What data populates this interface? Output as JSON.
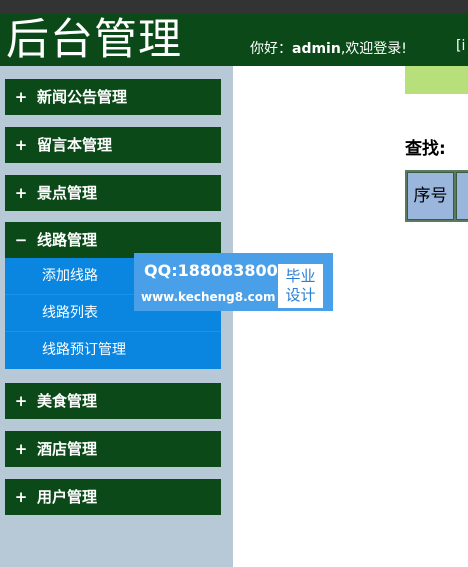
{
  "header": {
    "site_title": "后台管理",
    "welcome_prefix": "你好：",
    "username": "admin",
    "welcome_suffix": ",欢迎登录!",
    "cutoff_text": "[i"
  },
  "sidebar": {
    "menu": [
      {
        "sign": "+",
        "label": "新闻公告管理"
      },
      {
        "sign": "+",
        "label": "留言本管理"
      },
      {
        "sign": "+",
        "label": "景点管理"
      },
      {
        "sign": "−",
        "label": "线路管理"
      },
      {
        "sign": "+",
        "label": "美食管理"
      },
      {
        "sign": "+",
        "label": "酒店管理"
      },
      {
        "sign": "+",
        "label": "用户管理"
      }
    ],
    "route_submenu": [
      {
        "label": "添加线路"
      },
      {
        "label": "线路列表"
      },
      {
        "label": "线路预订管理"
      }
    ]
  },
  "main": {
    "search_label": "查找:",
    "table_headers": [
      "序号",
      ""
    ]
  },
  "watermark": {
    "qq": "QQ:188083800",
    "url": "www.kecheng8.com",
    "badge_line1": "毕业",
    "badge_line2": "设计"
  },
  "colors": {
    "header_bg": "#0b4a18",
    "sidebar_bg": "#b7c8d6",
    "submenu_bg": "#0a86e0",
    "accent_bar": "#b8e07a",
    "table_header_bg": "#9bb6dc"
  }
}
